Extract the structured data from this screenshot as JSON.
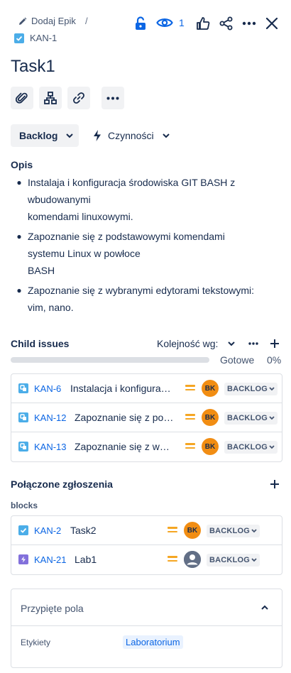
{
  "header": {
    "add_epic_label": "Dodaj Epik",
    "separator": "/",
    "issue_key": "KAN-1",
    "watchers_count": "1"
  },
  "title": "Task1",
  "status_button": "Backlog",
  "actions_button": "Czynności",
  "description": {
    "heading": "Opis",
    "items": [
      [
        "Instalaja i konfiguracja środowiska GIT BASH z wbudowanymi",
        "komendami linuxowymi."
      ],
      [
        "Zapoznanie się z podstawowymi komendami systemu Linux w powłoce",
        "BASH"
      ],
      [
        "Zapoznanie się z wybranymi edytorami tekstowymi: vim, nano."
      ]
    ]
  },
  "child_issues": {
    "heading": "Child issues",
    "sort_label": "Kolejność wg:",
    "progress_label": "Gotowe",
    "progress_percent": "0%",
    "progress_value": 0,
    "rows": [
      {
        "key": "KAN-6",
        "summary": "Instalacja i konfiguracja środowiska GIT BASH",
        "avatar": "BK",
        "status": "BACKLOG"
      },
      {
        "key": "KAN-12",
        "summary": "Zapoznanie się z podstawowymi komendami",
        "avatar": "BK",
        "status": "BACKLOG"
      },
      {
        "key": "KAN-13",
        "summary": "Zapoznanie się z wybranymi edytorami",
        "avatar": "BK",
        "status": "BACKLOG"
      }
    ]
  },
  "linked": {
    "heading": "Połączone zgłoszenia",
    "relation": "blocks",
    "rows": [
      {
        "key": "KAN-2",
        "summary": "Task2",
        "avatar": "BK",
        "status": "BACKLOG",
        "type": "task"
      },
      {
        "key": "KAN-21",
        "summary": "Lab1",
        "avatar": "",
        "status": "BACKLOG",
        "type": "subtask-purple"
      }
    ]
  },
  "pinned": {
    "heading": "Przypięte pola",
    "field_label": "Etykiety",
    "field_value": "Laboratorium"
  },
  "colors": {
    "accent": "#0c66e4",
    "priority": "#f5a623",
    "avatar": "#f18d13",
    "task_type": "#4bade8",
    "subtask_type": "#8270db"
  },
  "icons": [
    "pencil-icon",
    "checkbox-icon",
    "unlock-icon",
    "eye-icon",
    "thumbs-up-icon",
    "share-icon",
    "more-icon",
    "close-icon",
    "attachment-icon",
    "hierarchy-icon",
    "link-icon",
    "chevron-down-icon",
    "lightning-icon",
    "plus-icon",
    "chevron-up-icon",
    "priority-medium-icon",
    "user-icon"
  ]
}
